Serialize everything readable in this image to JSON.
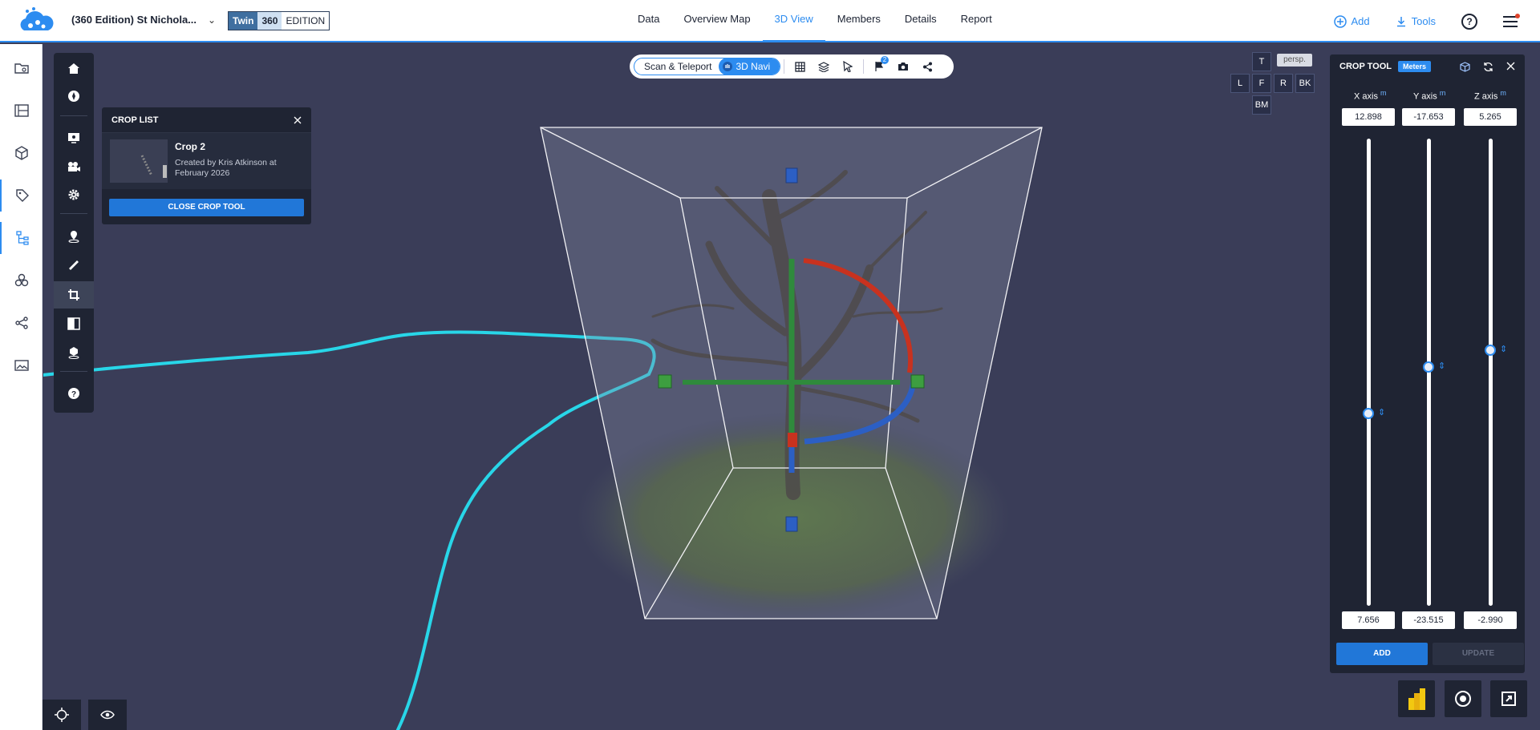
{
  "header": {
    "project_title": "(360 Edition) St Nichola...",
    "edition": {
      "twin": "Twin",
      "e360": "360",
      "ed": "EDITION"
    },
    "nav": [
      {
        "label": "Data"
      },
      {
        "label": "Overview Map"
      },
      {
        "label": "3D View",
        "active": true
      },
      {
        "label": "Members"
      },
      {
        "label": "Details"
      },
      {
        "label": "Report"
      }
    ],
    "add_label": "Add",
    "tools_label": "Tools",
    "help_symbol": "?"
  },
  "viewer_toolbar": {
    "scan_teleport": "Scan & Teleport",
    "navi": "3D Navi",
    "flag_count": "2"
  },
  "view_cube": {
    "top": "T",
    "left": "L",
    "front": "F",
    "right": "R",
    "back": "BK",
    "bottom": "BM",
    "projection": "persp."
  },
  "crop_list": {
    "title": "CROP LIST",
    "item": {
      "name": "Crop 2",
      "meta": "Created by Kris Atkinson at February 2026"
    },
    "close_button": "CLOSE CROP TOOL"
  },
  "crop_tool": {
    "title": "CROP TOOL",
    "units": "Meters",
    "unit_sup": "m",
    "axes": [
      {
        "label": "X axis",
        "max": "12.898",
        "min": "7.656",
        "knob_fraction": 0.59
      },
      {
        "label": "Y axis",
        "max": "-17.653",
        "min": "-23.515",
        "knob_fraction": 0.49
      },
      {
        "label": "Z axis",
        "max": "5.265",
        "min": "-2.990",
        "knob_fraction": 0.455
      }
    ],
    "add_button": "ADD",
    "update_button": "UPDATE"
  },
  "colors": {
    "accent": "#2d8cf0",
    "panel": "#1f2433",
    "viewport_bg": "#3a3d58",
    "path_line": "#28d6e8",
    "axis_red": "#c8321f",
    "axis_green": "#2f8a3c",
    "axis_blue": "#2c5fc4"
  }
}
